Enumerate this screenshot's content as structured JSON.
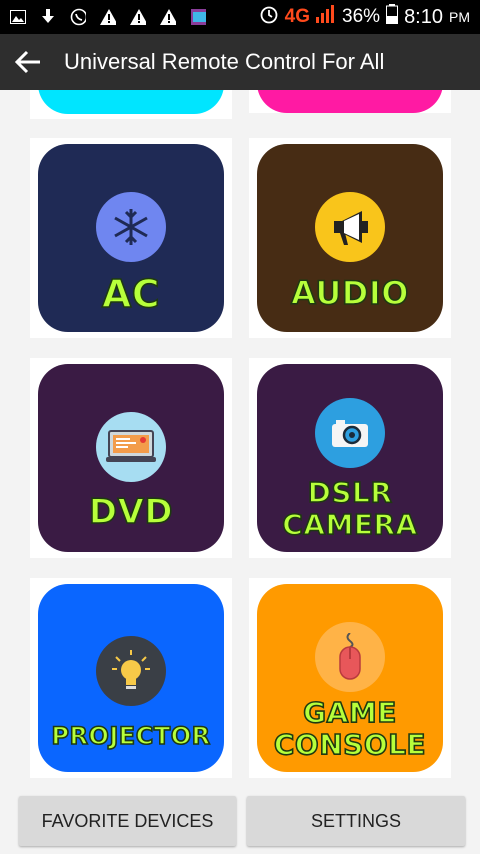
{
  "status_bar": {
    "network": "4G",
    "battery": "36%",
    "time": "8:10",
    "ampm": "PM"
  },
  "app_bar": {
    "title": "Universal Remote Control For All"
  },
  "devices": [
    {
      "label": "AC",
      "color": "#1f2a55",
      "circle": "#6f86f0",
      "icon": "snowflake-icon"
    },
    {
      "label": "AUDIO",
      "color": "#472c14",
      "circle": "#f9c51b",
      "icon": "megaphone-icon"
    },
    {
      "label": "DVD",
      "color": "#3a1b44",
      "circle": "#a7ddf2",
      "icon": "dvd-player-icon"
    },
    {
      "label": "DSLR",
      "label2": "CAMERA",
      "color": "#3a1b44",
      "circle": "#2d9fe0",
      "icon": "camera-icon"
    },
    {
      "label": "PROJECTOR",
      "color": "#0a66ff",
      "circle": "#3a3f46",
      "icon": "bulb-icon"
    },
    {
      "label": "GAME",
      "label2": "CONSOLE",
      "color": "#ff9a00",
      "circle": "#ffb347",
      "icon": "mouse-icon"
    }
  ],
  "partial_tiles": {
    "left_color": "#00e5ff",
    "right_color": "#ff1aa3"
  },
  "bottom": {
    "favorites_label": "FAVORITE DEVICES",
    "settings_label": "SETTINGS"
  }
}
